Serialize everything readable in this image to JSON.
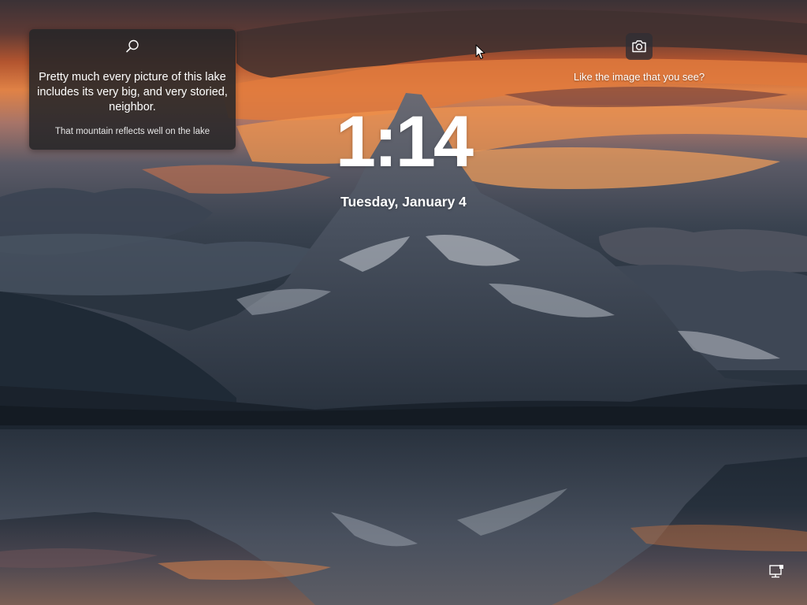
{
  "lockscreen": {
    "clock_time": "1:14",
    "date": "Tuesday, January 4"
  },
  "spotlight_card": {
    "search_icon": "search-icon",
    "headline": "Pretty much every picture of this lake includes its very big, and very storied, neighbor.",
    "subline": "That mountain reflects well on the lake"
  },
  "like_image": {
    "icon": "camera-icon",
    "label": "Like the image that you see?"
  },
  "system_tray": {
    "network_icon": "network-icon"
  },
  "colors": {
    "sky_dark": "#3a3438",
    "sunset_orange": "#d97f4a",
    "card_background": "#262628",
    "text": "#ffffff"
  }
}
